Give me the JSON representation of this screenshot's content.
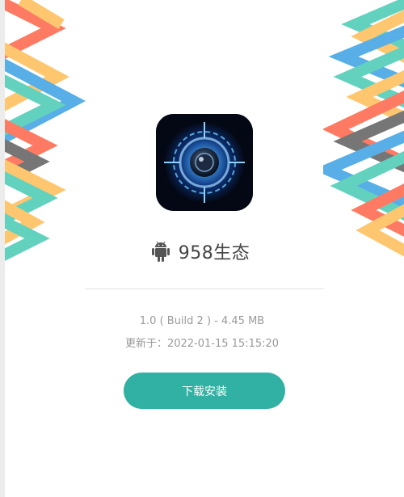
{
  "app": {
    "name": "958生态",
    "icon": "camera-lens-icon",
    "platform_icon": "android-icon"
  },
  "info": {
    "version_line": "1.0 ( Build 2 ) - 4.45 MB",
    "updated_label": "更新于：",
    "updated_value": "2022-01-15 15:15:20"
  },
  "actions": {
    "download_label": "下载安装"
  },
  "colors": {
    "button": "#30b1a3",
    "deco_red": "#ff5a3c",
    "deco_orange": "#ffb84d",
    "deco_teal": "#3cc8b0",
    "deco_blue": "#2f9be0"
  }
}
